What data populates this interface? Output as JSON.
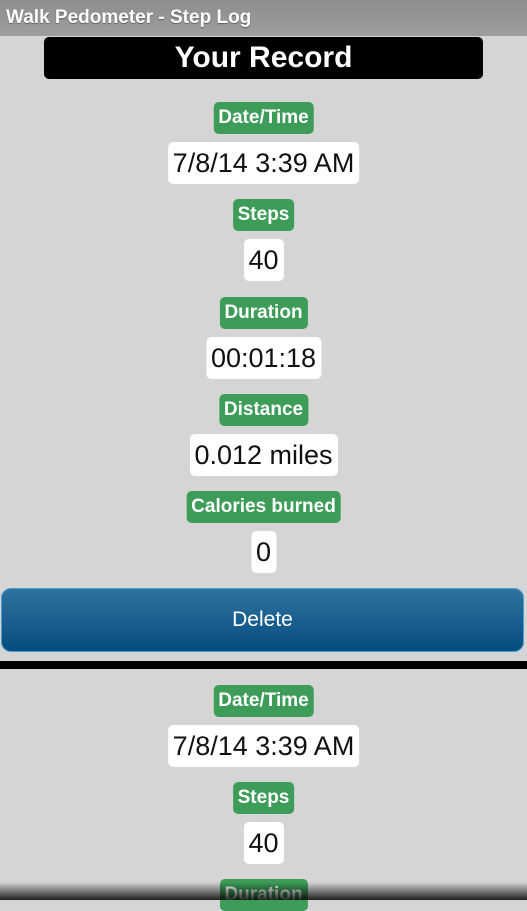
{
  "app": {
    "title": "Walk Pedometer - Step Log"
  },
  "header": {
    "title": "Your Record"
  },
  "records": [
    {
      "fields": [
        {
          "label": "Date/Time",
          "value": "7/8/14 3:39 AM"
        },
        {
          "label": "Steps",
          "value": "40"
        },
        {
          "label": "Duration",
          "value": "00:01:18"
        },
        {
          "label": "Distance",
          "value": "0.012 miles"
        },
        {
          "label": "Calories burned",
          "value": "0"
        }
      ],
      "delete_label": "Delete"
    },
    {
      "fields": [
        {
          "label": "Date/Time",
          "value": "7/8/14 3:39 AM"
        },
        {
          "label": "Steps",
          "value": "40"
        },
        {
          "label": "Duration",
          "value": ""
        }
      ]
    }
  ],
  "colors": {
    "label_green": "#3d9d58",
    "button_blue": "#0b5a8c",
    "background": "#d5d5d5"
  }
}
